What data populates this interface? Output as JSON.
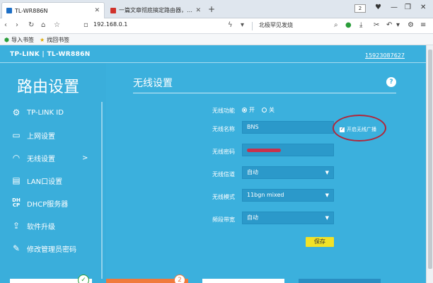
{
  "browser": {
    "tabs": [
      {
        "title": "TL-WR886N",
        "active": true
      },
      {
        "title": "一篇文章彻底搞定路由器，以TP-LINK",
        "active": false
      }
    ],
    "new_tab": "+",
    "tab_count": "2",
    "url": "192.168.0.1",
    "search_hint": "北极罕见发烧",
    "bookmarks": [
      {
        "label": "导入书签",
        "icon": "import-icon"
      },
      {
        "label": "找回书签",
        "icon": "star-icon"
      }
    ]
  },
  "router": {
    "brand": "TP-LINK | TL-WR886N",
    "account": "15923087627",
    "sidebar_title": "路由设置",
    "menu": [
      {
        "label": "TP-LINK ID",
        "icon": "gear-icon"
      },
      {
        "label": "上网设置",
        "icon": "laptop-icon"
      },
      {
        "label": "无线设置",
        "icon": "wifi-icon",
        "arrow": ">"
      },
      {
        "label": "LAN口设置",
        "icon": "lan-icon"
      },
      {
        "label": "DHCP服务器",
        "icon": "dhcp-icon"
      },
      {
        "label": "软件升级",
        "icon": "upload-icon"
      },
      {
        "label": "修改管理员密码",
        "icon": "pencil-icon"
      }
    ],
    "panel_title": "无线设置",
    "help": "?",
    "form": {
      "wireless_label": "无线功能",
      "wireless_on": "开",
      "wireless_off": "关",
      "ssid_label": "无线名称",
      "ssid_value": "BNS",
      "broadcast_label": "开启无线广播",
      "password_label": "无线密码",
      "password_value": "",
      "channel_label": "无线信道",
      "channel_value": "自动",
      "mode_label": "无线模式",
      "mode_value": "11bgn mixed",
      "bandwidth_label": "频段带宽",
      "bandwidth_value": "自动",
      "save_label": "保存"
    }
  },
  "colors": {
    "page_bg": "#3bb0dd",
    "field_bg": "#2b99ca",
    "save_bg": "#f2e227",
    "annotation": "#b1263a"
  }
}
